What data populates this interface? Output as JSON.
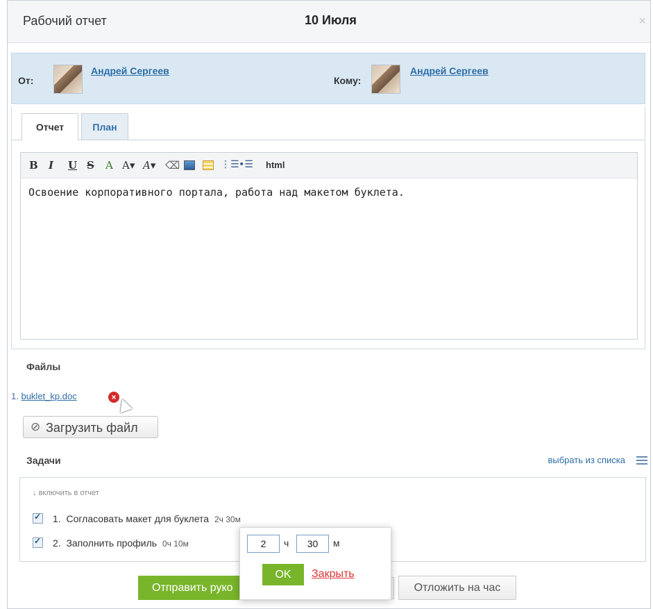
{
  "dialog": {
    "title": "Рабочий отчет",
    "date": "10 Июля",
    "close_icon": "close-icon"
  },
  "people": {
    "from_label": "От:",
    "from_name": "Андрей Сергеев",
    "to_label": "Кому:",
    "to_name": "Андрей Сергеев"
  },
  "tabs": [
    {
      "label": "Отчет",
      "active": true
    },
    {
      "label": "План",
      "active": false
    }
  ],
  "toolbar": {
    "buttons": [
      "B",
      "I",
      "U",
      "S",
      "A",
      "A▾",
      "A▾",
      "eraser-icon",
      "image-icon",
      "table-icon",
      "ordered-list-icon",
      "unordered-list-icon",
      "html"
    ],
    "html_label": "html"
  },
  "editor": {
    "text": "Освоение корпоративного портала, работа над макетом буклета."
  },
  "files": {
    "title": "Файлы",
    "items": [
      {
        "index": "1.",
        "name": "buklet_kp.doc"
      }
    ],
    "upload_label": "Загрузить файл"
  },
  "tasks": {
    "title": "Задачи",
    "pick_label": "выбрать из списка",
    "include_label": "включить в отчет",
    "items": [
      {
        "index": "1.",
        "name": "Согласовать макет для буклета",
        "duration": "2ч 30м",
        "checked": true
      },
      {
        "index": "2.",
        "name": "Заполнить профиль",
        "duration": "0ч 10м",
        "checked": true
      }
    ]
  },
  "time_popup": {
    "hours": "2",
    "hours_unit": "ч",
    "minutes": "30",
    "minutes_unit": "м",
    "ok_label": "OK",
    "close_label": "Закрыть"
  },
  "footer": {
    "send_label": "Отправить руко",
    "delay_label": "Отложить на час"
  },
  "colors": {
    "accent_green": "#79b52b",
    "link_blue": "#2e6ea6",
    "header_blue": "#d9e8f3"
  }
}
